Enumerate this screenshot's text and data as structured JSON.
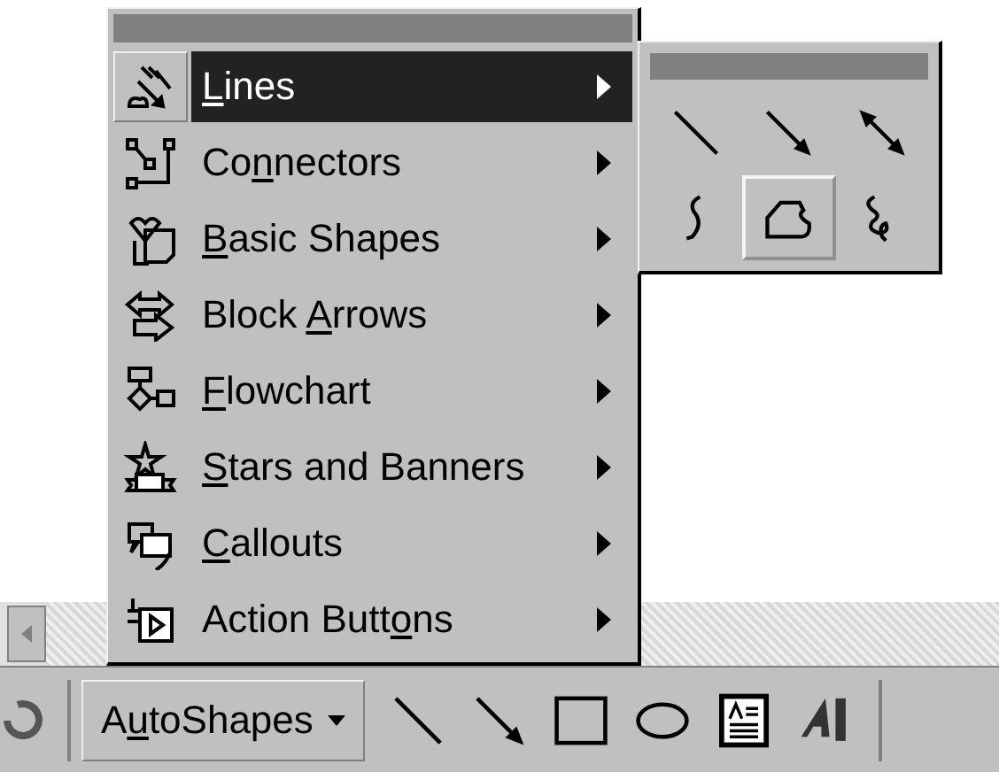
{
  "menu": {
    "items": [
      {
        "kind": "lines",
        "label": {
          "key": "L",
          "after": "ines"
        },
        "selected": true
      },
      {
        "kind": "connectors",
        "label": {
          "before": "Co",
          "key": "n",
          "after": "nectors"
        },
        "selected": false
      },
      {
        "kind": "basic-shapes",
        "label": {
          "key": "B",
          "after": "asic Shapes"
        },
        "selected": false
      },
      {
        "kind": "block-arrows",
        "label": {
          "before": "Block ",
          "key": "A",
          "after": "rrows"
        },
        "selected": false
      },
      {
        "kind": "flowchart",
        "label": {
          "key": "F",
          "after": "lowchart"
        },
        "selected": false
      },
      {
        "kind": "stars",
        "label": {
          "key": "S",
          "after": "tars and Banners"
        },
        "selected": false
      },
      {
        "kind": "callouts",
        "label": {
          "key": "C",
          "after": "allouts"
        },
        "selected": false
      },
      {
        "kind": "action-buttons",
        "label": {
          "before": "Action Butt",
          "key": "o",
          "after": "ns"
        },
        "selected": false
      }
    ]
  },
  "submenu": {
    "tools": [
      {
        "kind": "line",
        "selected": false
      },
      {
        "kind": "arrow",
        "selected": false
      },
      {
        "kind": "double-arrow",
        "selected": false
      },
      {
        "kind": "curve",
        "selected": false
      },
      {
        "kind": "freeform",
        "selected": true
      },
      {
        "kind": "scribble",
        "selected": false
      }
    ]
  },
  "toolbar": {
    "autoshapes": {
      "before": "A",
      "key": "u",
      "after": "toShapes"
    },
    "tools": [
      {
        "kind": "line"
      },
      {
        "kind": "arrow"
      },
      {
        "kind": "rectangle"
      },
      {
        "kind": "oval"
      },
      {
        "kind": "text-box"
      },
      {
        "kind": "wordart"
      }
    ]
  }
}
